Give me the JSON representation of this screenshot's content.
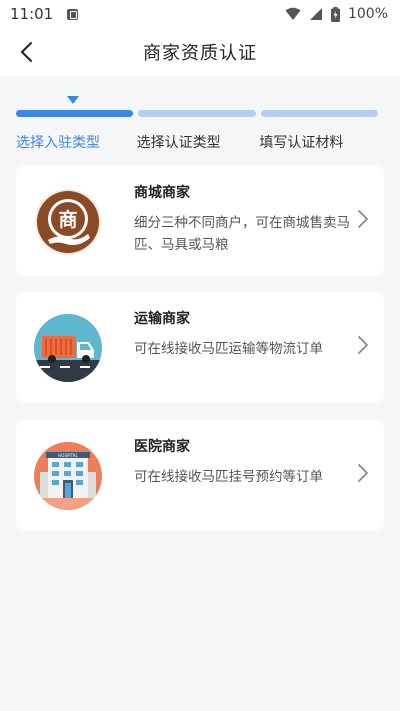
{
  "status_bar": {
    "time": "11:01",
    "battery": "100%"
  },
  "header": {
    "title": "商家资质认证"
  },
  "steps": {
    "items": [
      {
        "label": "选择入驻类型",
        "active": true
      },
      {
        "label": "选择认证类型",
        "active": false
      },
      {
        "label": "填写认证材料",
        "active": false
      }
    ],
    "accent_color": "#3b86e6",
    "inactive_color": "#b6cdf0"
  },
  "cards": [
    {
      "title": "商城商家",
      "description": "细分三种不同商户，可在商城售卖马匹、马具或马粮",
      "icon": "shop-merchant-icon",
      "icon_glyph": "商"
    },
    {
      "title": "运输商家",
      "description": "可在线接收马匹运输等物流订单",
      "icon": "truck-icon"
    },
    {
      "title": "医院商家",
      "description": "可在线接收马匹挂号预约等订单",
      "icon": "hospital-icon",
      "icon_sign": "HOSPITAL"
    }
  ]
}
